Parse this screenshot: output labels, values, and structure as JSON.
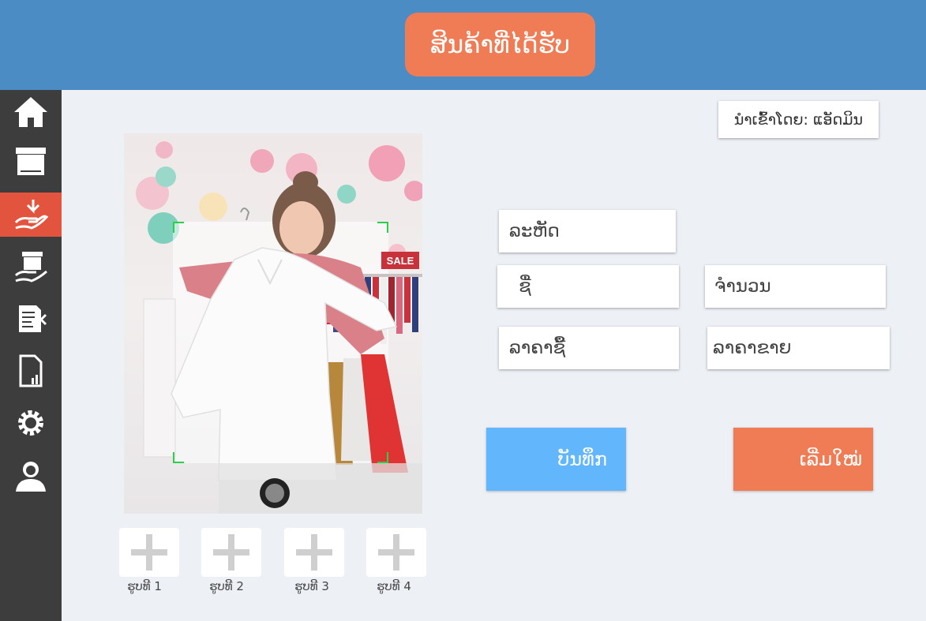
{
  "header": {
    "title": "ສິນຄ້າທີ່ໄດ້ຮັບ"
  },
  "sidebar": {
    "items": [
      {
        "icon": "home-icon"
      },
      {
        "icon": "box-icon"
      },
      {
        "icon": "receive-goods-icon",
        "active": true
      },
      {
        "icon": "deliver-box-icon"
      },
      {
        "icon": "invoice-icon"
      },
      {
        "icon": "report-icon"
      },
      {
        "icon": "gear-icon"
      },
      {
        "icon": "user-icon"
      }
    ]
  },
  "imported_by": "ນຳເຂົ້າໂດຍ: ແອັດມິນ",
  "form": {
    "code_placeholder": "ລະຫັດ",
    "name_placeholder": "ຊື່",
    "quantity_placeholder": "ຈຳນວນ",
    "buy_price_placeholder": "ລາຄາຊື້",
    "sell_price_placeholder": "ລາຄາຂາຍ"
  },
  "buttons": {
    "save_label": "ບັນທຶກ",
    "reset_label": "ເລີ່ມໃໝ່"
  },
  "photo": {
    "sign_text": "SALE"
  },
  "thumbnails": [
    {
      "label": "ຮູບທີ 1"
    },
    {
      "label": "ຮູບທີ 2"
    },
    {
      "label": "ຮູບທີ 3"
    },
    {
      "label": "ຮູບທີ 4"
    }
  ],
  "colors": {
    "header": "#4b8cc4",
    "accent": "#f07c55",
    "sidebar": "#3d3d3d",
    "active": "#e2543d",
    "save": "#62b6fb"
  }
}
